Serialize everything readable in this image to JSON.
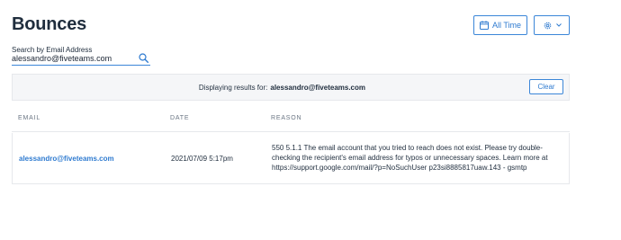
{
  "page": {
    "title": "Bounces"
  },
  "toolbar": {
    "time_range_label": "All Time"
  },
  "search": {
    "label": "Search by Email Address",
    "value": "alessandro@fiveteams.com"
  },
  "results": {
    "prefix": "Displaying results for:",
    "query": "alessandro@fiveteams.com",
    "clear_label": "Clear"
  },
  "table": {
    "headers": {
      "email": "EMAIL",
      "date": "DATE",
      "reason": "REASON"
    },
    "rows": [
      {
        "email": "alessandro@fiveteams.com",
        "date": "2021/07/09 5:17pm",
        "reason": "550 5.1.1 The email account that you tried to reach does not exist. Please try double-checking the recipient's email address for typos or unnecessary spaces. Learn more at https://support.google.com/mail/?p=NoSuchUser p23si8885817uaw.143 - gsmtp"
      }
    ]
  },
  "colors": {
    "accent": "#3b86d8",
    "link": "#2f7bd0",
    "bar_bg": "#f5f6f8"
  },
  "icons": {
    "time": "calendar-icon",
    "settings": "gear-icon",
    "settings_caret": "chevron-down-icon",
    "search": "search-icon"
  }
}
